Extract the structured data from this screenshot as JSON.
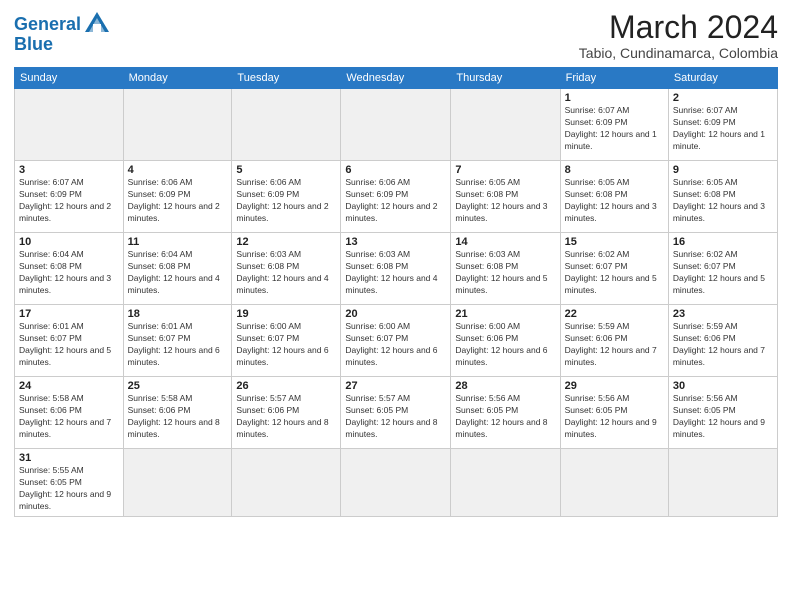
{
  "header": {
    "logo_general": "General",
    "logo_blue": "Blue",
    "month_title": "March 2024",
    "location": "Tabio, Cundinamarca, Colombia"
  },
  "days_of_week": [
    "Sunday",
    "Monday",
    "Tuesday",
    "Wednesday",
    "Thursday",
    "Friday",
    "Saturday"
  ],
  "weeks": [
    [
      {
        "day": "",
        "info": ""
      },
      {
        "day": "",
        "info": ""
      },
      {
        "day": "",
        "info": ""
      },
      {
        "day": "",
        "info": ""
      },
      {
        "day": "",
        "info": ""
      },
      {
        "day": "1",
        "info": "Sunrise: 6:07 AM\nSunset: 6:09 PM\nDaylight: 12 hours and 1 minute."
      },
      {
        "day": "2",
        "info": "Sunrise: 6:07 AM\nSunset: 6:09 PM\nDaylight: 12 hours and 1 minute."
      }
    ],
    [
      {
        "day": "3",
        "info": "Sunrise: 6:07 AM\nSunset: 6:09 PM\nDaylight: 12 hours and 2 minutes."
      },
      {
        "day": "4",
        "info": "Sunrise: 6:06 AM\nSunset: 6:09 PM\nDaylight: 12 hours and 2 minutes."
      },
      {
        "day": "5",
        "info": "Sunrise: 6:06 AM\nSunset: 6:09 PM\nDaylight: 12 hours and 2 minutes."
      },
      {
        "day": "6",
        "info": "Sunrise: 6:06 AM\nSunset: 6:09 PM\nDaylight: 12 hours and 2 minutes."
      },
      {
        "day": "7",
        "info": "Sunrise: 6:05 AM\nSunset: 6:08 PM\nDaylight: 12 hours and 3 minutes."
      },
      {
        "day": "8",
        "info": "Sunrise: 6:05 AM\nSunset: 6:08 PM\nDaylight: 12 hours and 3 minutes."
      },
      {
        "day": "9",
        "info": "Sunrise: 6:05 AM\nSunset: 6:08 PM\nDaylight: 12 hours and 3 minutes."
      }
    ],
    [
      {
        "day": "10",
        "info": "Sunrise: 6:04 AM\nSunset: 6:08 PM\nDaylight: 12 hours and 3 minutes."
      },
      {
        "day": "11",
        "info": "Sunrise: 6:04 AM\nSunset: 6:08 PM\nDaylight: 12 hours and 4 minutes."
      },
      {
        "day": "12",
        "info": "Sunrise: 6:03 AM\nSunset: 6:08 PM\nDaylight: 12 hours and 4 minutes."
      },
      {
        "day": "13",
        "info": "Sunrise: 6:03 AM\nSunset: 6:08 PM\nDaylight: 12 hours and 4 minutes."
      },
      {
        "day": "14",
        "info": "Sunrise: 6:03 AM\nSunset: 6:08 PM\nDaylight: 12 hours and 5 minutes."
      },
      {
        "day": "15",
        "info": "Sunrise: 6:02 AM\nSunset: 6:07 PM\nDaylight: 12 hours and 5 minutes."
      },
      {
        "day": "16",
        "info": "Sunrise: 6:02 AM\nSunset: 6:07 PM\nDaylight: 12 hours and 5 minutes."
      }
    ],
    [
      {
        "day": "17",
        "info": "Sunrise: 6:01 AM\nSunset: 6:07 PM\nDaylight: 12 hours and 5 minutes."
      },
      {
        "day": "18",
        "info": "Sunrise: 6:01 AM\nSunset: 6:07 PM\nDaylight: 12 hours and 6 minutes."
      },
      {
        "day": "19",
        "info": "Sunrise: 6:00 AM\nSunset: 6:07 PM\nDaylight: 12 hours and 6 minutes."
      },
      {
        "day": "20",
        "info": "Sunrise: 6:00 AM\nSunset: 6:07 PM\nDaylight: 12 hours and 6 minutes."
      },
      {
        "day": "21",
        "info": "Sunrise: 6:00 AM\nSunset: 6:06 PM\nDaylight: 12 hours and 6 minutes."
      },
      {
        "day": "22",
        "info": "Sunrise: 5:59 AM\nSunset: 6:06 PM\nDaylight: 12 hours and 7 minutes."
      },
      {
        "day": "23",
        "info": "Sunrise: 5:59 AM\nSunset: 6:06 PM\nDaylight: 12 hours and 7 minutes."
      }
    ],
    [
      {
        "day": "24",
        "info": "Sunrise: 5:58 AM\nSunset: 6:06 PM\nDaylight: 12 hours and 7 minutes."
      },
      {
        "day": "25",
        "info": "Sunrise: 5:58 AM\nSunset: 6:06 PM\nDaylight: 12 hours and 8 minutes."
      },
      {
        "day": "26",
        "info": "Sunrise: 5:57 AM\nSunset: 6:06 PM\nDaylight: 12 hours and 8 minutes."
      },
      {
        "day": "27",
        "info": "Sunrise: 5:57 AM\nSunset: 6:05 PM\nDaylight: 12 hours and 8 minutes."
      },
      {
        "day": "28",
        "info": "Sunrise: 5:56 AM\nSunset: 6:05 PM\nDaylight: 12 hours and 8 minutes."
      },
      {
        "day": "29",
        "info": "Sunrise: 5:56 AM\nSunset: 6:05 PM\nDaylight: 12 hours and 9 minutes."
      },
      {
        "day": "30",
        "info": "Sunrise: 5:56 AM\nSunset: 6:05 PM\nDaylight: 12 hours and 9 minutes."
      }
    ],
    [
      {
        "day": "31",
        "info": "Sunrise: 5:55 AM\nSunset: 6:05 PM\nDaylight: 12 hours and 9 minutes."
      },
      {
        "day": "",
        "info": ""
      },
      {
        "day": "",
        "info": ""
      },
      {
        "day": "",
        "info": ""
      },
      {
        "day": "",
        "info": ""
      },
      {
        "day": "",
        "info": ""
      },
      {
        "day": "",
        "info": ""
      }
    ]
  ]
}
